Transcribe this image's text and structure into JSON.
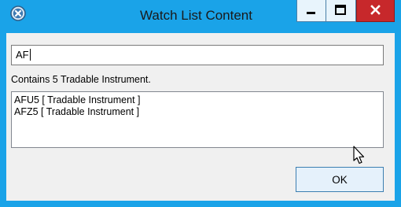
{
  "window": {
    "title": "Watch List Content",
    "icon": "app-close-circle-icon",
    "controls": {
      "minimize_icon": "minimize-icon",
      "maximize_icon": "maximize-icon",
      "close_icon": "close-icon"
    }
  },
  "search": {
    "value": "AF"
  },
  "summary": {
    "text": "Contains 5 Tradable Instrument."
  },
  "results": {
    "items": [
      "AFU5 [ Tradable Instrument ]",
      "AFZ5 [ Tradable Instrument ]"
    ]
  },
  "actions": {
    "ok_label": "OK"
  },
  "colors": {
    "frame": "#1aa3e8",
    "close_button": "#c7282b",
    "client_background": "#f0f0f0",
    "button_background": "#e5f1fb",
    "button_border": "#3c7fb1"
  }
}
